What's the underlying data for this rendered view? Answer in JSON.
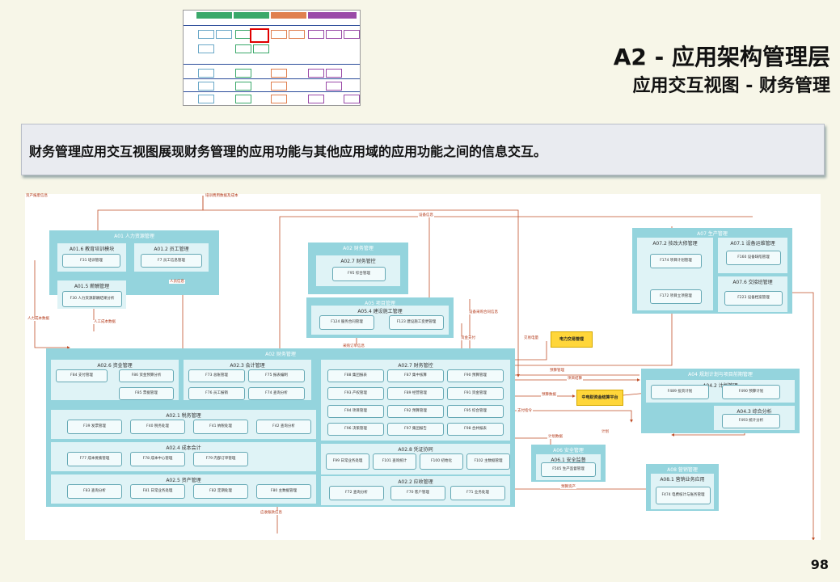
{
  "title": {
    "line1": "A2 - 应用架构管理层",
    "line2": "应用交互视图 - 财务管理"
  },
  "banner": "财务管理应用交互视图展现财务管理的应用功能与其他应用域的应用功能之间的信息交互。",
  "page_number": "98",
  "domains": [
    {
      "label": "A01 人力资源管理",
      "subs": [
        {
          "label": "A01.6 教育培训模块",
          "fns": [
            "F31 培训管理"
          ]
        },
        {
          "label": "A01.2 员工管理",
          "fns": [
            "F7 员工信息管理"
          ]
        },
        {
          "label": "A01.5 薪酬管理",
          "fns": [
            "F30 人力资源薪酬结果分析"
          ]
        }
      ]
    },
    {
      "label": "A02 财务管理",
      "subs": [
        {
          "label": "A02.7 财务管控",
          "fns": [
            "F95 综合管理"
          ]
        }
      ]
    },
    {
      "label": "A05 项目管理",
      "subs": [
        {
          "label": "A05.4 建设施工管理",
          "fns": [
            "F124 服务合同管理",
            "F123 建设施工变更管理"
          ]
        }
      ]
    },
    {
      "label": "A02 财务管理",
      "subs": [
        {
          "label": "A02.6 资金管理",
          "fns": [
            "F84 支付管理",
            "F86 资金预算分析",
            "F85 票据管理"
          ]
        },
        {
          "label": "A02.3 会计管理",
          "fns": [
            "F73 总账管理",
            "F75 报表编制",
            "F76 员工报销",
            "F74 查询分析"
          ]
        },
        {
          "label": "A02.7 财务管控",
          "fns": [
            "F88 集团报表",
            "F87 集中核算",
            "F90 预算管理",
            "F93 产权管理",
            "F89 经营管理",
            "F91 资金管理",
            "F94 项目管理",
            "F92 预算管理",
            "F95 综合管理",
            "F96 决策管理",
            "F97 集团报告",
            "F98 合并报表"
          ]
        },
        {
          "label": "A02.1 税务管理",
          "fns": [
            "F39 发票管理",
            "F40 税务处理",
            "F41 纳税处理",
            "F42 查询分析"
          ]
        },
        {
          "label": "A02.4 成本会计",
          "fns": [
            "F77 成本要素管理",
            "F78 成本中心管理",
            "F79 内部订单管理"
          ]
        },
        {
          "label": "A02.8 凭证协同",
          "fns": [
            "F99 日常业务处理",
            "F101 查询统计",
            "F100 初始化",
            "F102 主数据管理"
          ]
        },
        {
          "label": "A02.5 资产管理",
          "fns": [
            "F83 查询分析",
            "F81 日常业务处理",
            "F82 定期处理",
            "F80 主数据管理"
          ]
        },
        {
          "label": "A02.2 应收管理",
          "fns": [
            "F72 查询分析",
            "F70 客户管理",
            "F71 业务处理"
          ]
        }
      ]
    },
    {
      "label": "A07 生产管理",
      "subs": [
        {
          "label": "A07.2 技改大修管理",
          "fns": [
            "F174 项目计划管理",
            "F172 项目立项管理"
          ]
        },
        {
          "label": "A07.1 设备运维管理",
          "fns": [
            "F160 设备缺陷管理"
          ]
        },
        {
          "label": "A07.6 交接班管理",
          "fns": [
            "F223 设备档案管理"
          ]
        }
      ]
    },
    {
      "label": "A04 规划计划与项目前期管理",
      "subs": [
        {
          "label": "A04.2 计划管理",
          "fns": [
            "F489 投资计划",
            "F490 预算计划"
          ]
        },
        {
          "label": "A04.3 综合分析",
          "fns": [
            "F493 统计分析"
          ]
        }
      ]
    },
    {
      "label": "A06 安全管理",
      "subs": [
        {
          "label": "A06.1 安全监督",
          "fns": [
            "F505 生产监督管理"
          ]
        }
      ]
    },
    {
      "label": "A08 营销管理",
      "subs": [
        {
          "label": "A08.1 营销业务应用",
          "fns": [
            "F474 电费核计与账务管理"
          ]
        }
      ]
    }
  ],
  "externals": [
    "电力交易管理",
    "中电财资金结算平台"
  ],
  "edge_labels": [
    "培训费用数据及成本",
    "设备信息",
    "人员信息",
    "人力成本数据",
    "人工成本数据",
    "采购订单信息",
    "设备采购合同信息",
    "资金支付",
    "交易电量",
    "预算管理",
    "项目结算",
    "预算数据",
    "支付指令",
    "计划",
    "计划数据",
    "预算资产",
    "应收账款信息",
    "资产报废信息"
  ]
}
